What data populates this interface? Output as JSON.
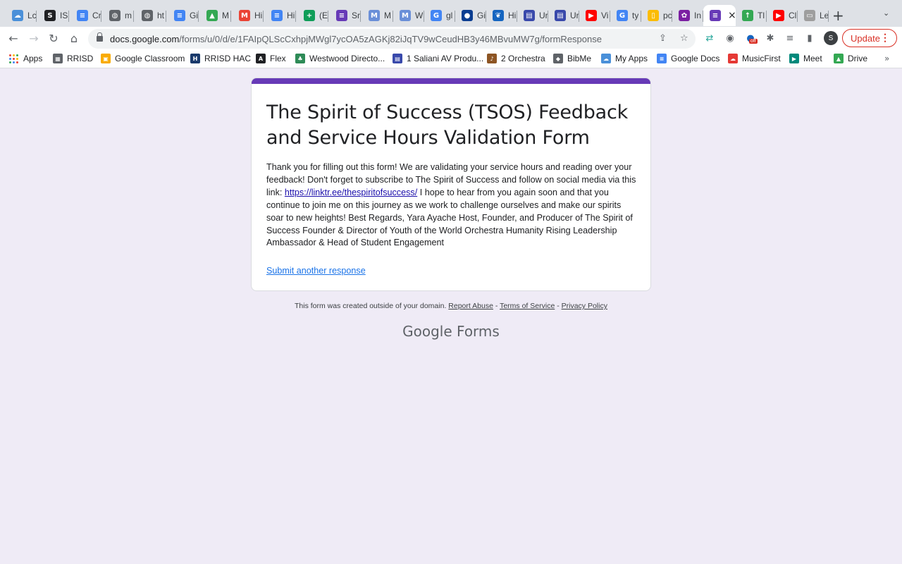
{
  "tabs": [
    {
      "title": "Lc",
      "icon": "cloud-icon",
      "color": "#4a90d9"
    },
    {
      "title": "IS",
      "icon": "s-logo-icon",
      "color": "#202124"
    },
    {
      "title": "Cr",
      "icon": "docs-icon",
      "color": "#4285f4"
    },
    {
      "title": "m",
      "icon": "globe-icon",
      "color": "#5f6368"
    },
    {
      "title": "ht",
      "icon": "globe-icon",
      "color": "#5f6368"
    },
    {
      "title": "Gi",
      "icon": "docs-icon",
      "color": "#4285f4"
    },
    {
      "title": "M",
      "icon": "drive-icon",
      "color": "#34a853"
    },
    {
      "title": "Hi",
      "icon": "gmail-icon",
      "color": "#ea4335"
    },
    {
      "title": "Hi",
      "icon": "docs-icon",
      "color": "#4285f4"
    },
    {
      "title": "(E",
      "icon": "sheets-icon",
      "color": "#0f9d58"
    },
    {
      "title": "Sr",
      "icon": "forms-icon",
      "color": "#673ab7"
    },
    {
      "title": "M",
      "icon": "musescore-icon",
      "color": "#6a8fd8"
    },
    {
      "title": "W",
      "icon": "musescore-icon",
      "color": "#6a8fd8"
    },
    {
      "title": "gl",
      "icon": "google-icon",
      "color": "#4285f4"
    },
    {
      "title": "Gi",
      "icon": "nasa-icon",
      "color": "#0b3d91"
    },
    {
      "title": "Hi",
      "icon": "leaf-icon",
      "color": "#1565c0"
    },
    {
      "title": "Ur",
      "icon": "calendar-icon",
      "color": "#3949ab"
    },
    {
      "title": "Ur",
      "icon": "calendar-icon",
      "color": "#3949ab"
    },
    {
      "title": "Vi",
      "icon": "youtube-icon",
      "color": "#ff0000"
    },
    {
      "title": "ty",
      "icon": "google-icon",
      "color": "#4285f4"
    },
    {
      "title": "pc",
      "icon": "note-icon",
      "color": "#fbbc04"
    },
    {
      "title": "In",
      "icon": "puzzle-icon",
      "color": "#7b1fa2"
    },
    {
      "title": "",
      "icon": "forms-icon",
      "color": "#673ab7",
      "active": true
    },
    {
      "title": "Tl",
      "icon": "arrow-up-icon",
      "color": "#34a853"
    },
    {
      "title": "Cl",
      "icon": "youtube-icon",
      "color": "#ff0000"
    },
    {
      "title": "Le",
      "icon": "document-icon",
      "color": "#9e9e9e"
    }
  ],
  "toolbar": {
    "url_host": "docs.google.com",
    "url_path": "/forms/u/0/d/e/1FAIpQLScCxhpjMWgl7ycOA5zAGKj82iJqTV9wCeudHB3y46MBvuMW7g/formResponse",
    "profile_initial": "S",
    "update_label": "Update",
    "ext_badge": "off"
  },
  "bookmarks": [
    {
      "label": "Apps",
      "icon": "apps-grid-icon"
    },
    {
      "label": "RRISD",
      "icon": "building-icon",
      "color": "#5f6368"
    },
    {
      "label": "Google Classroom",
      "icon": "classroom-icon",
      "color": "#f9ab00"
    },
    {
      "label": "RRISD HAC",
      "icon": "hac-icon",
      "color": "#1a3a6b"
    },
    {
      "label": "Flex",
      "icon": "angular-icon",
      "color": "#202124"
    },
    {
      "label": "Westwood Directo...",
      "icon": "leaf-circle-icon",
      "color": "#2e8b57"
    },
    {
      "label": "1 Saliani AV Produ...",
      "icon": "calendar-icon",
      "color": "#3949ab"
    },
    {
      "label": "2 Orchestra",
      "icon": "music-icon",
      "color": "#8d5524"
    },
    {
      "label": "BibMe",
      "icon": "book-icon",
      "color": "#5f6368"
    },
    {
      "label": "My Apps",
      "icon": "cloud-icon",
      "color": "#4a90d9"
    },
    {
      "label": "Google Docs",
      "icon": "docs-icon",
      "color": "#4285f4"
    },
    {
      "label": "MusicFirst",
      "icon": "cloud-outline-icon",
      "color": "#e53935"
    },
    {
      "label": "Meet",
      "icon": "meet-icon",
      "color": "#00897b"
    },
    {
      "label": "Drive",
      "icon": "drive-icon",
      "color": "#34a853"
    }
  ],
  "bookmarks_more": "»",
  "form": {
    "accent_color": "#673ab7",
    "title": "The Spirit of Success (TSOS) Feedback and Service Hours Validation Form",
    "message_before_link": "Thank you for filling out this form! We are validating your service hours and reading over your feedback! Don't forget to subscribe to The Spirit of Success and follow on social media via this link: ",
    "link_text": "https://linktr.ee/thespiritofsuccess/",
    "message_after_link": " I hope to hear from you again soon and that you continue to join me on this journey as we work to challenge ourselves and make our spirits soar to new heights!   Best Regards,   Yara Ayache  Host, Founder, and Producer of The Spirit of Success Founder & Director of Youth of the World Orchestra Humanity Rising Leadership Ambassador & Head of Student Engagement",
    "submit_again": "Submit another response"
  },
  "footer": {
    "notice": "This form was created outside of your domain.",
    "report_abuse": "Report Abuse",
    "sep": " - ",
    "terms": "Terms of Service",
    "privacy": "Privacy Policy",
    "logo_google": "Google",
    "logo_forms": "Forms"
  }
}
